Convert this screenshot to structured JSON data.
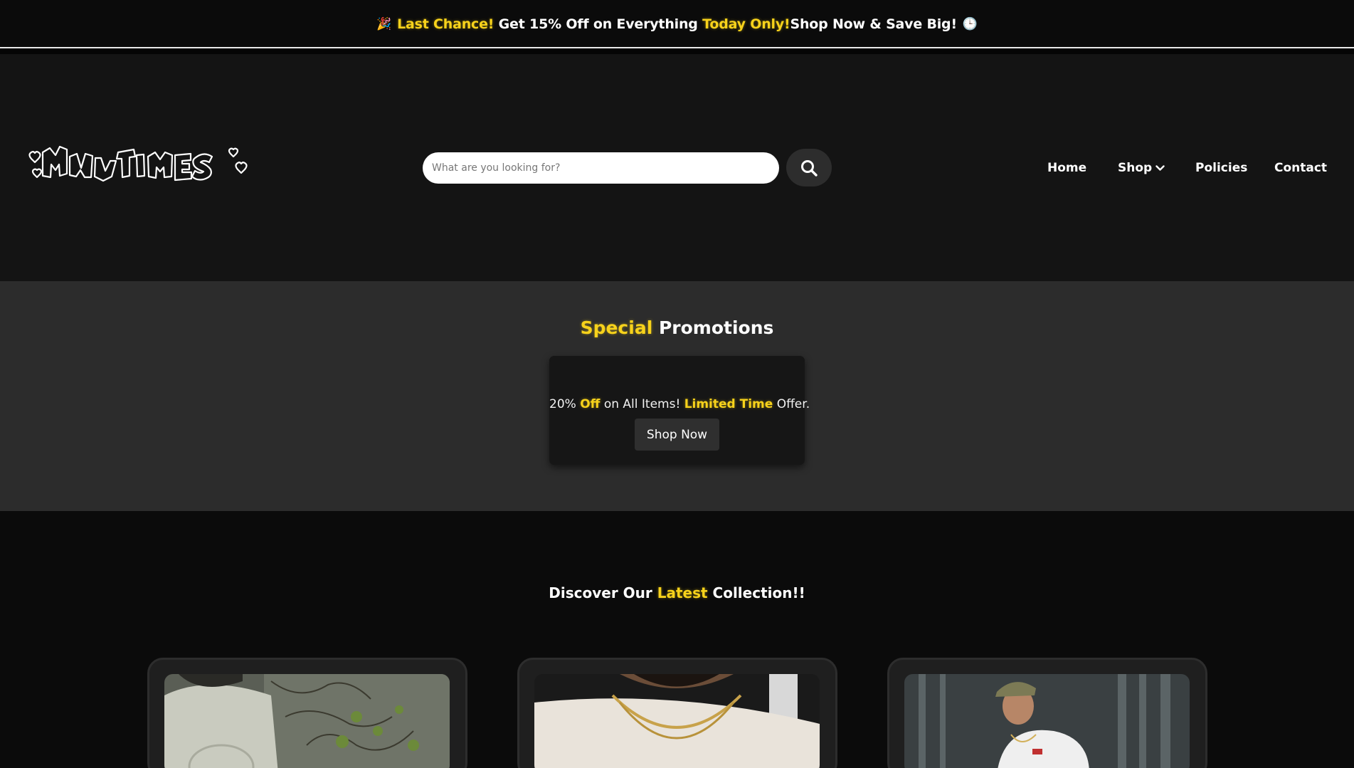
{
  "announcement": {
    "emoji_left": "🎉",
    "part1": "Last Chance!",
    "part2": " Get 15% Off on Everything ",
    "part3": "Today Only!",
    "part4": "Shop Now & Save Big!",
    "emoji_right": "🕒"
  },
  "header": {
    "logo_text": "MANY TIMES",
    "search": {
      "placeholder": "What are you looking for?"
    },
    "nav": {
      "home": "Home",
      "shop": "Shop",
      "policies": "Policies",
      "contact": "Contact"
    }
  },
  "promotions": {
    "title_highlight": "Special",
    "title_rest": " Promotions",
    "offer": {
      "p1": "20% ",
      "p2": "Off",
      "p3": " on All Items! ",
      "p4": "Limited Time",
      "p5": " Offer."
    },
    "button": "Shop Now"
  },
  "collection": {
    "title_p1": "Discover Our ",
    "title_p2": "Latest",
    "title_p3": " Collection!!"
  },
  "colors": {
    "accent": "#f7d21b",
    "background": "#0b0b0b",
    "header_bg": "#141414",
    "promo_bg": "#2c2c2c"
  },
  "icons": [
    "search-icon",
    "chevron-down-icon",
    "party-popper-icon",
    "clock-icon"
  ]
}
